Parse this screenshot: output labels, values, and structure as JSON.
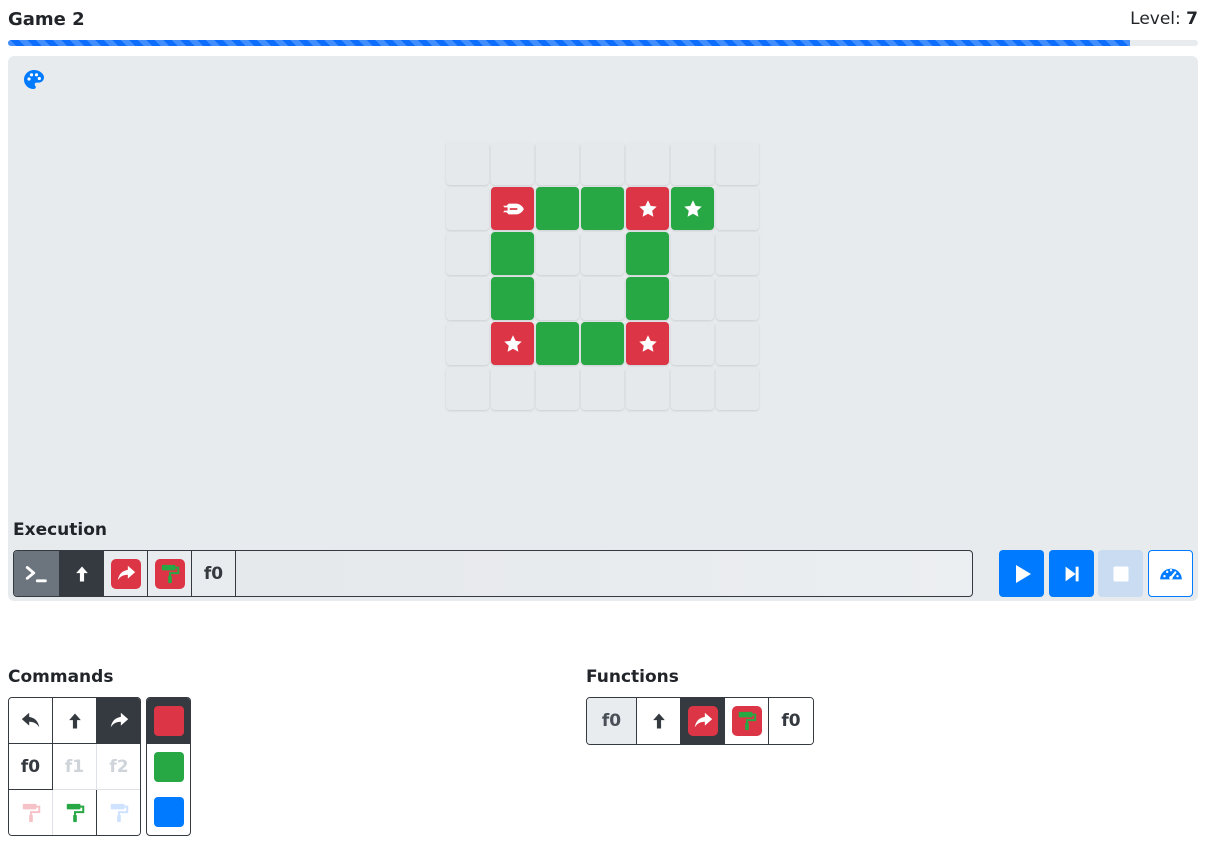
{
  "header": {
    "title": "Game 2",
    "level_label": "Level:",
    "level_value": "7",
    "progress_fraction": 0.943
  },
  "board": {
    "palette_icon": "palette-icon",
    "rows": [
      [
        "empty",
        "empty",
        "empty",
        "empty",
        "empty",
        "empty",
        "empty"
      ],
      [
        "empty",
        "red-ship",
        "green",
        "green",
        "red-star",
        "green-star",
        "empty"
      ],
      [
        "empty",
        "green",
        "empty",
        "empty",
        "green",
        "empty",
        "empty"
      ],
      [
        "empty",
        "green",
        "empty",
        "empty",
        "green",
        "empty",
        "empty"
      ],
      [
        "empty",
        "red-star",
        "green",
        "green",
        "red-star",
        "empty",
        "empty"
      ],
      [
        "empty",
        "empty",
        "empty",
        "empty",
        "empty",
        "empty",
        "empty"
      ]
    ]
  },
  "execution": {
    "label": "Execution",
    "items": [
      {
        "kind": "terminal",
        "icon": "terminal-icon"
      },
      {
        "kind": "forward",
        "icon": "arrow-up-icon"
      },
      {
        "kind": "turn-right-red",
        "icon": "turn-right-icon"
      },
      {
        "kind": "paint-green-red",
        "icon": "paint-roller-icon"
      },
      {
        "kind": "function",
        "label": "f0"
      }
    ],
    "controls": [
      "play-icon",
      "step-forward-icon",
      "stop-icon",
      "speedometer-icon"
    ]
  },
  "commands": {
    "label": "Commands",
    "grid": [
      [
        "turn-left-icon",
        "arrow-up-icon",
        "turn-right-icon"
      ],
      [
        "f0",
        "f1",
        "f2"
      ],
      [
        "paint-red-icon",
        "paint-green-icon",
        "paint-blue-icon"
      ]
    ],
    "colors": [
      "#dc3545",
      "#28a745",
      "#007bff"
    ]
  },
  "functions": {
    "label": "Functions",
    "name": "f0",
    "call_label": "f0"
  },
  "colors": {
    "accent": "#007bff",
    "red": "#dc3545",
    "green": "#28a745",
    "dark": "#343a40",
    "board_bg": "#e8ebee"
  }
}
